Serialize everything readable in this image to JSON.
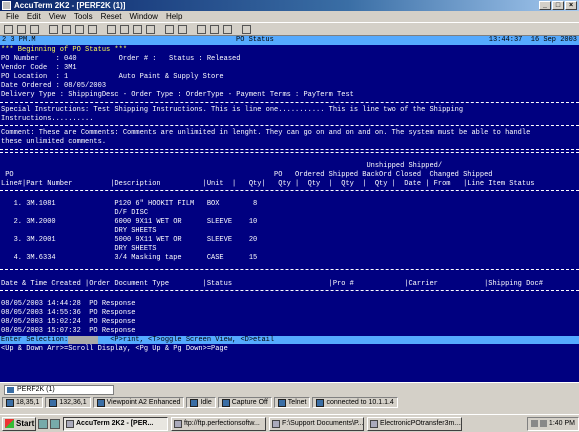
{
  "window": {
    "title": "AccuTerm 2K2 - [PERF2K (1)]",
    "minimize": "_",
    "maximize": "□",
    "close": "×"
  },
  "menu": [
    "File",
    "Edit",
    "View",
    "Tools",
    "Reset",
    "Window",
    "Help"
  ],
  "toolbar": [
    "new-icon",
    "open-icon",
    "save-icon",
    "sep",
    "print-icon",
    "cut-icon",
    "copy-icon",
    "paste-icon",
    "sep",
    "settings-icon",
    "link-icon",
    "check-icon",
    "web-icon",
    "sep",
    "help-icon",
    "about-icon",
    "sep",
    "window-icon",
    "network-icon",
    "transfer-icon",
    "sep",
    "info-icon"
  ],
  "terminal": {
    "status_left": "2 3 PM.M",
    "status_center": "PO Status",
    "status_right": "13:44:37  16 Sep 2003",
    "header_line": "*** Beginning of PO Status ***",
    "po_number": "PO Number    : 040          Order # :   Status : Released",
    "vendor": "Vendor Code  : 3M1",
    "location": "PO Location  : 1            Auto Paint & Supply Store",
    "date_ordered": "Date Ordered : 08/05/2003",
    "delivery": "Delivery Type : ShippingDesc - Order Type : OrderType - Payment Terms : PayTerm Test",
    "special1": "Special Instructions: Test Shipping Instructions. This is line one........... This is line two of the Shipping",
    "special2": "Instructions..........",
    "comment1": "Comment: These are Comments: Comments are unlimited in lenght. They can go on and on and on. The system must be able to handle",
    "comment2": "these unlimited comments.",
    "col_head1": "                                                                                       Unshipped Shipped/",
    "col_head2": " PO                                                              PO   Ordered Shipped BackOrd Closed  Changed Shipped",
    "col_head3": "Line#|Part Number         |Description          |Unit  |   Qty|   Qty |  Qty  |  Qty  |  Qty |  Date | From   |Line Item Status",
    "lines": [
      "   1. 3M.1081              P120 6\" HOOKIT FILM   BOX        8",
      "                           D/F DISC",
      "   2. 3M.2000              6000 9X11 WET OR      SLEEVE    10",
      "                           DRY SHEETS",
      "   3. 3M.2001              5000 9X11 WET OR      SLEEVE    20",
      "                           DRY SHEETS",
      "   4. 3M.6334              3/4 Masking tape      CASE      15"
    ],
    "hist_head": "Date & Time Created |Order Document Type        |Status                       |Pro #            |Carrier           |Shipping Doc#",
    "history": [
      "08/05/2003 14:44:28  PO Response",
      "08/05/2003 14:55:36  PO Response",
      "08/05/2003 15:02:24  PO Response",
      "08/05/2003 15:07:32  PO Response"
    ],
    "prompt": "Enter Selection:          <P>rint, <T>oggle Screen View, <D>etail",
    "prompt2": "<Up & Down Arr>=Scroll Display, <Pg Up & Pg Down>=Page"
  },
  "session_tab": "PERF2K (1)",
  "statusbar": [
    {
      "icon": "position-icon",
      "text": "18,35,1"
    },
    {
      "icon": "grid-icon",
      "text": "132,36,1"
    },
    {
      "icon": "emulation-icon",
      "text": "Viewpoint A2 Enhanced"
    },
    {
      "icon": "idle-icon",
      "text": "Idle"
    },
    {
      "icon": "capture-icon",
      "text": "Capture Off"
    },
    {
      "icon": "telnet-icon",
      "text": "Telnet"
    },
    {
      "icon": "connection-icon",
      "text": "connected to 10.1.1.4"
    }
  ],
  "taskbar": {
    "start": "Start",
    "buttons": [
      {
        "label": "AccuTerm 2K2 - [PER...",
        "active": true
      },
      {
        "label": "ftp://ftp.perfectionsoftw...",
        "active": false
      },
      {
        "label": "F:\\Support Documents\\P...",
        "active": false
      },
      {
        "label": "ElectronicPOtransfer3m....",
        "active": false
      }
    ],
    "clock": "1:40 PM"
  }
}
